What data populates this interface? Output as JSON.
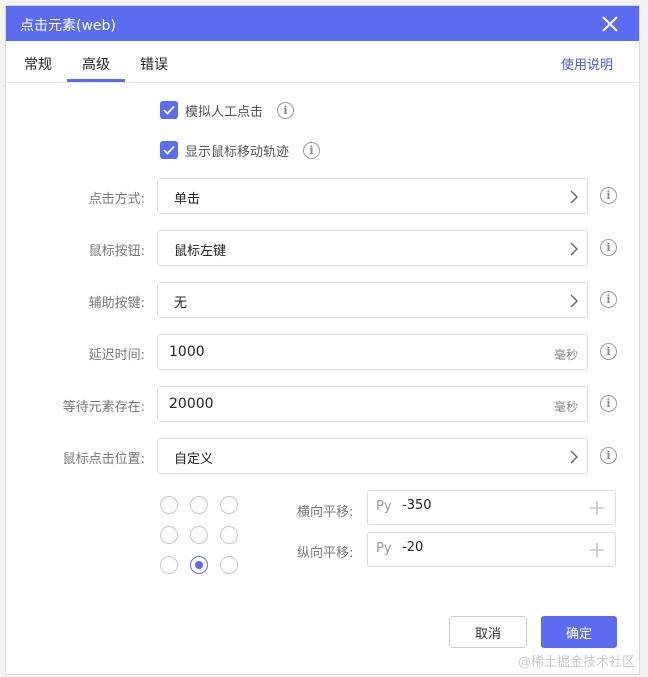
{
  "dialog": {
    "title": "点击元素(web)",
    "close_icon": "close-icon"
  },
  "tabs": [
    {
      "label": "常规",
      "active": false
    },
    {
      "label": "高级",
      "active": true
    },
    {
      "label": "错误",
      "active": false
    }
  ],
  "help_link": "使用说明",
  "checkboxes": [
    {
      "label": "模拟人工点击",
      "checked": true
    },
    {
      "label": "显示鼠标移动轨迹",
      "checked": true
    }
  ],
  "fields": {
    "click_mode": {
      "label": "点击方式:",
      "value": "单击"
    },
    "mouse_button": {
      "label": "鼠标按钮:",
      "value": "鼠标左键"
    },
    "modifier_key": {
      "label": "辅助按键:",
      "value": "无"
    },
    "delay": {
      "label": "延迟时间:",
      "value": "1000",
      "unit": "毫秒"
    },
    "wait_element": {
      "label": "等待元素存在:",
      "value": "20000",
      "unit": "毫秒"
    },
    "click_position": {
      "label": "鼠标点击位置:",
      "value": "自定义"
    }
  },
  "position_grid": {
    "selected_index": 7
  },
  "offsets": {
    "horizontal": {
      "label": "横向平移:",
      "prefix": "Py",
      "value": "-350"
    },
    "vertical": {
      "label": "纵向平移:",
      "prefix": "Py",
      "value": "-20"
    }
  },
  "buttons": {
    "cancel": "取消",
    "ok": "确定"
  },
  "watermark": "@稀土掘金技术社区",
  "colors": {
    "accent": "#5b6cf0"
  }
}
